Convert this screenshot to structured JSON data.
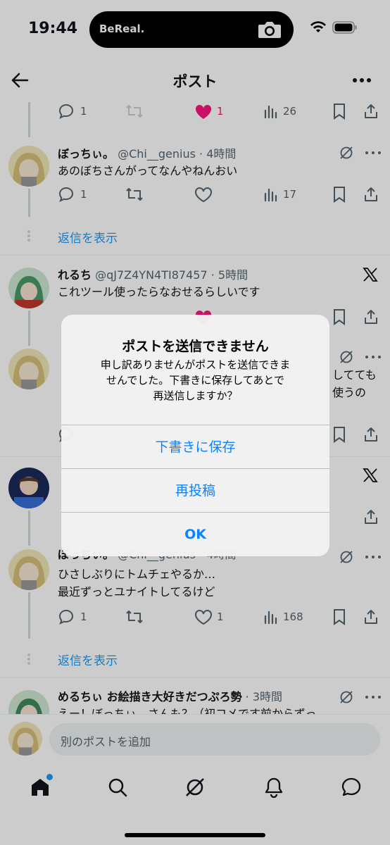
{
  "status": {
    "time": "19:44",
    "island_label": "BeReal."
  },
  "header": {
    "title": "ポスト"
  },
  "top_actions": {
    "replies": "1",
    "likes": "1",
    "views": "26"
  },
  "posts": [
    {
      "name": "ぼっちぃ。",
      "handle": "@Chi__genius",
      "time": "· 4時間",
      "text_lines": [
        "あのぼちさんがってなんやねんおい"
      ],
      "replies": "1",
      "likes": "",
      "views": "17"
    },
    {
      "name": "れるち",
      "handle": "@qJ7Z4YN4TI87457",
      "time": "· 5時間",
      "text_lines": [
        "これツール使ったらなおせるらしいです"
      ]
    },
    {
      "name": "ぼっちぃ。",
      "handle": "@Chi__genius",
      "time": "· 4時間",
      "text_lines": [
        "ひさしぶりにトムチェやるか…",
        "最近ずっとユナイトしてるけど"
      ],
      "replies": "1",
      "likes": "1",
      "views": "168"
    },
    {
      "name": "めるちぃ お絵描き大好きだつぷろ勢",
      "handle": "",
      "time": "· 3時間",
      "text_lines": [
        "えー！ぼっちぃ…さんも？（初コメです前からずっ"
      ]
    }
  ],
  "show_replies": "返信を表示",
  "partial_texts": [
    "してても",
    "使うの"
  ],
  "dialog": {
    "title": "ポストを送信できません",
    "message_lines": [
      "申し訳ありませんがポストを送信できま",
      "せんでした。下書きに保存してあとで",
      "再送信しますか？"
    ],
    "buttons": [
      "下書きに保存",
      "再投稿",
      "OK"
    ]
  },
  "reply": {
    "placeholder": "別のポストを追加"
  },
  "tabs": [
    "home",
    "search",
    "grok",
    "notifications",
    "messages"
  ],
  "colors": {
    "like": "#f91880",
    "link": "#1d9bf0",
    "ios_blue": "#0a84ff"
  }
}
